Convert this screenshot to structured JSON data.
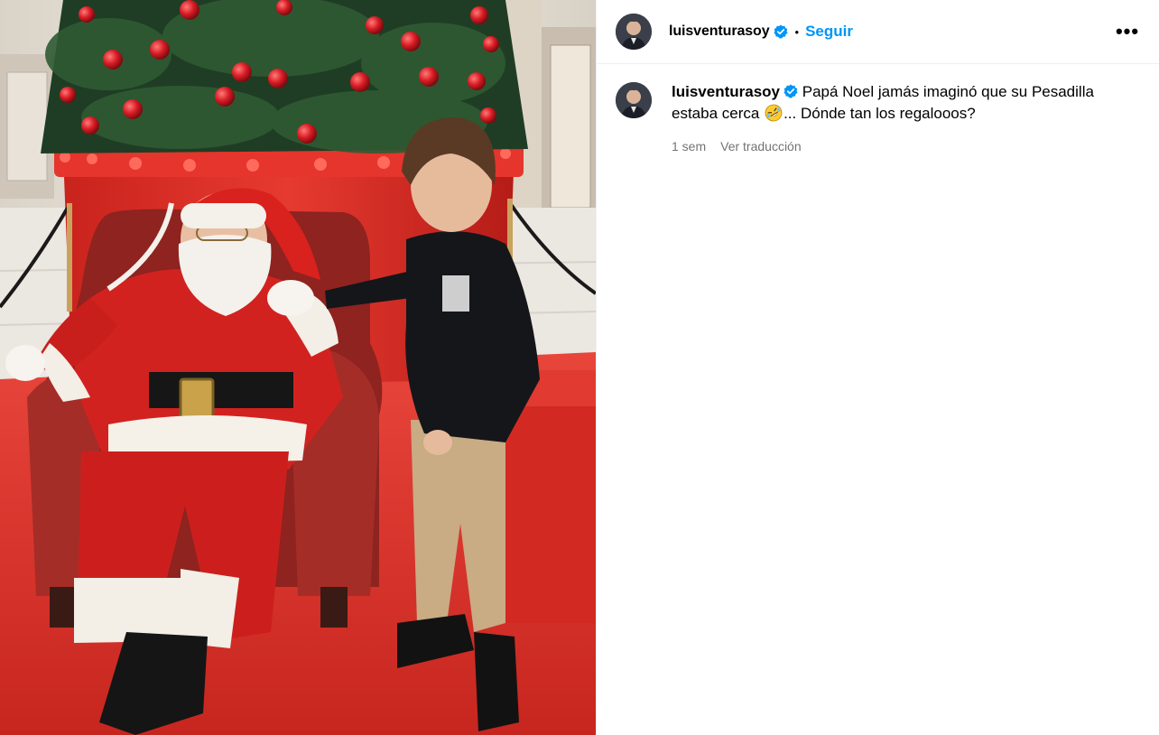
{
  "post": {
    "photo_alt": "",
    "author": {
      "username": "luisventurasoy",
      "verified": true,
      "avatar_icon": "profile-avatar"
    },
    "header": {
      "separator": "•",
      "follow_label": "Seguir",
      "more_icon": "more-options-icon",
      "more_label": "•••"
    },
    "caption": {
      "username": "luisventurasoy",
      "text_before_emoji": "Papá Noel jamás imaginó que su Pesadilla estaba cerca",
      "emoji": "rolling-on-floor-laughing-emoji",
      "text_after_emoji": "... Dónde tan los regalooos?",
      "time": "1 sem",
      "translate_label": "Ver traducción"
    },
    "colors": {
      "follow": "#0095f6",
      "meta_text": "#737373",
      "verified": "#0095f6",
      "divider": "#efefef"
    }
  }
}
